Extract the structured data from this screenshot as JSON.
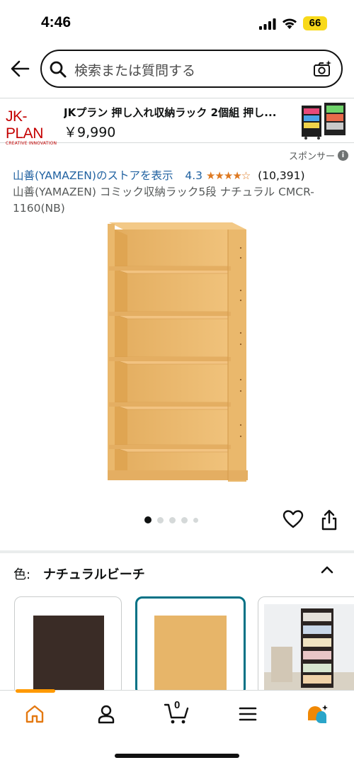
{
  "status_bar": {
    "time": "4:46",
    "battery": "66"
  },
  "search": {
    "placeholder": "検索または質問する"
  },
  "ad": {
    "brand_logo": "JK-PLAN",
    "brand_tagline": "CREATIVE INNOVATION",
    "title": "JKプラン 押し入れ収納ラック 2個組 押し...",
    "price": "￥9,990",
    "sponsor_label": "スポンサー"
  },
  "product": {
    "store_link": "山善(YAMAZEN)のストアを表示",
    "rating": "4.3",
    "stars": "★★★★☆",
    "review_count": "(10,391)",
    "title": "山善(YAMAZEN) コミック収納ラック5段 ナチュラル CMCR-1160(NB)",
    "image_count": 5,
    "current_image": 1
  },
  "variation": {
    "label": "色:",
    "selected": "ナチュラルビーチ",
    "swatches": [
      {
        "name": "dark-brown",
        "color": "#3a2c26"
      },
      {
        "name": "natural-beech",
        "color": "#e7b569",
        "selected": true
      },
      {
        "name": "photo"
      }
    ]
  },
  "nav": {
    "items": [
      "home",
      "account",
      "cart",
      "menu",
      "rufus"
    ],
    "cart_count": "0",
    "active": "home"
  },
  "colors": {
    "accent_orange": "#ff9900",
    "link_blue": "#2162a1",
    "star_orange": "#de7921",
    "selected_border": "#007185",
    "wood": "#eab86c"
  }
}
